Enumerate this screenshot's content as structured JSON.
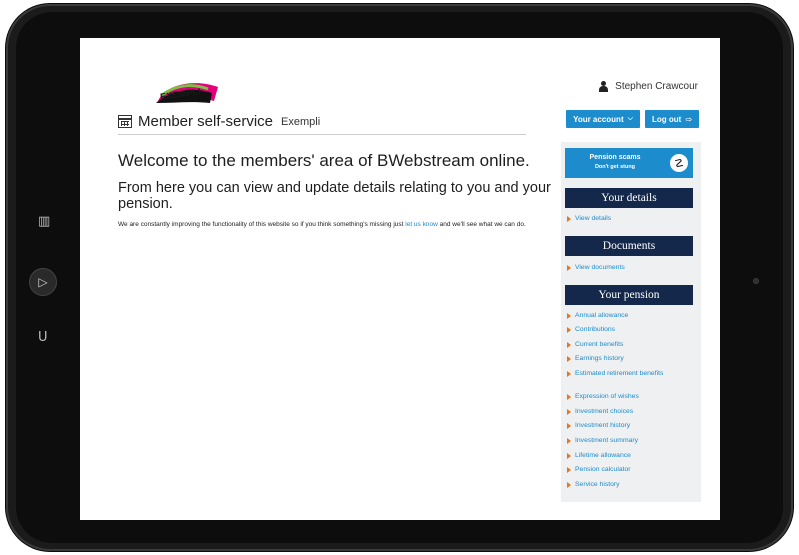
{
  "header": {
    "logo_text": "EXEMPLI",
    "user_name": "Stephen Crawcour",
    "page_title": "Member self-service",
    "page_subtitle": "Exempli",
    "account_button": "Your account",
    "logout_button": "Log out"
  },
  "main": {
    "welcome": "Welcome to the members' area of BWebstream online.",
    "subheading": "From here you can view and update details relating to you and your pension.",
    "body_before_link": "We are constantly improving the functionality of this website so if you think something's missing just ",
    "body_link": "let us know",
    "body_after_link": " and we'll see what we can do."
  },
  "sidebar": {
    "scam_title": "Pension scams",
    "scam_subtitle": "Don't get stung",
    "sections": [
      {
        "heading": "Your details",
        "links": [
          "View details"
        ]
      },
      {
        "heading": "Documents",
        "links": [
          "View documents"
        ]
      },
      {
        "heading": "Your pension",
        "links": [
          "Annual allowance",
          "Contributions",
          "Current benefits",
          "Earnings history",
          "Estimated retirement benefits",
          "Expression of wishes",
          "Investment choices",
          "Investment history",
          "Investment summary",
          "Lifetime allowance",
          "Pension calculator",
          "Service history"
        ]
      }
    ]
  },
  "colors": {
    "accent": "#1c8ccc",
    "sidebar_heading": "#14284b",
    "bullet": "#e8751e",
    "sidebar_bg": "#eef0f1"
  },
  "icons": {
    "tablet_left": [
      "volume-icon",
      "home-button-icon",
      "lock-icon"
    ],
    "user": "user-icon",
    "title": "calendar-icon",
    "account_chevron": "chevron-down-icon",
    "logout": "logout-icon",
    "scam": "scorpion-icon"
  }
}
